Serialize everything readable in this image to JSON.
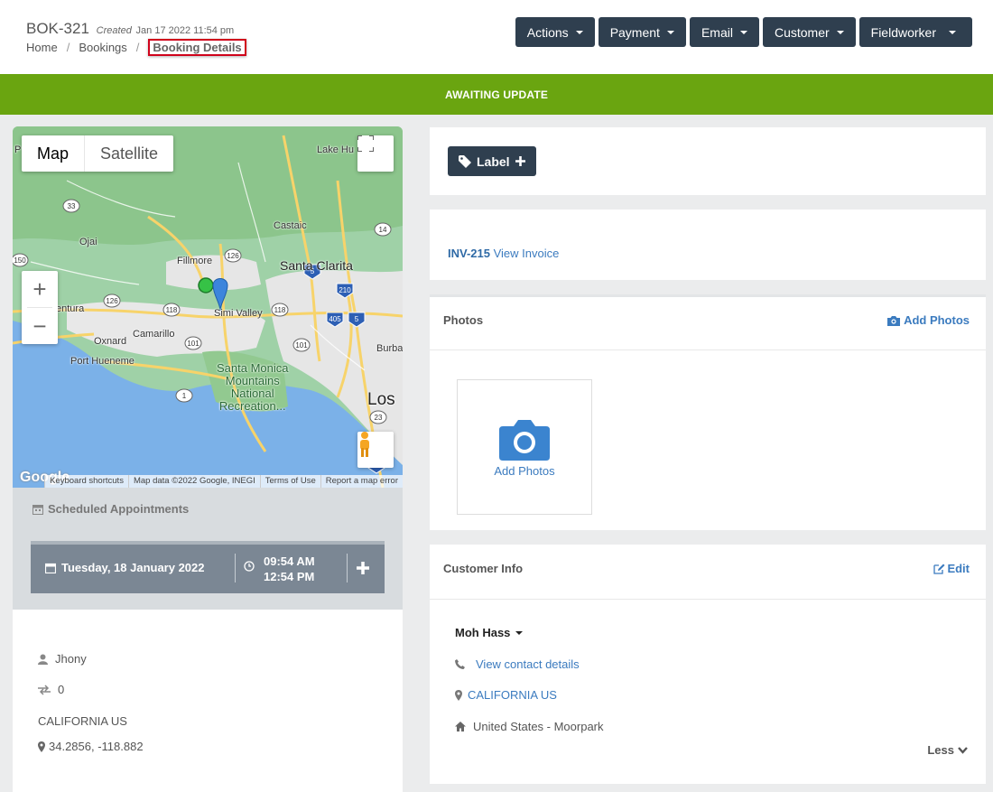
{
  "header": {
    "booking_ref": "BOK-321",
    "created_label": "Created",
    "created_date": "Jan 17 2022 11:54 pm",
    "breadcrumb": [
      "Home",
      "Bookings",
      "Booking Details"
    ],
    "actions": [
      "Actions",
      "Payment",
      "Email",
      "Customer",
      "Fieldworker"
    ]
  },
  "status": {
    "text": "AWAITING UPDATE",
    "color": "#6aa510"
  },
  "map": {
    "type_map": "Map",
    "type_satellite": "Satellite",
    "places": {
      "lake_hughes": "Lake Hu",
      "castaic": "Castaic",
      "ojai": "Ojai",
      "fillmore": "Fillmore",
      "santa_clarita": "Santa Clarita",
      "ventura": "entura",
      "simi_valley": "Simi Valley",
      "oxnard": "Oxnard",
      "camarillo": "Camarillo",
      "port_hueneme": "Port Hueneme",
      "santa_monica_mountains": "Santa Monica\nMountains\nNational\nRecreation...",
      "los": "Los",
      "burbank": "Burba",
      "p": "P"
    },
    "shields": [
      "33",
      "150",
      "126",
      "118",
      "126",
      "118",
      "101",
      "1",
      "5",
      "14",
      "210",
      "405",
      "5",
      "101",
      "405",
      "23"
    ],
    "attribution": [
      "Keyboard shortcuts",
      "Map data ©2022 Google, INEGI",
      "Terms of Use",
      "Report a map error"
    ],
    "logo": "Google"
  },
  "schedule": {
    "title": "Scheduled Appointments",
    "date": "Tuesday, 18 January 2022",
    "start": "09:54 AM",
    "end": "12:54 PM"
  },
  "info": {
    "worker": "Jhony",
    "transfers": "0",
    "region": "CALIFORNIA US",
    "coords": "34.2856, -118.882"
  },
  "label_button": "Label",
  "invoice": {
    "id": "INV-215",
    "link": "View Invoice"
  },
  "photos": {
    "title": "Photos",
    "add_link": "Add Photos",
    "add_box": "Add Photos"
  },
  "customer": {
    "title": "Customer Info",
    "edit": "Edit",
    "name": "Moh Hass",
    "contact": "View contact details",
    "location": "CALIFORNIA US",
    "address": "United States - Moorpark",
    "less": "Less"
  }
}
